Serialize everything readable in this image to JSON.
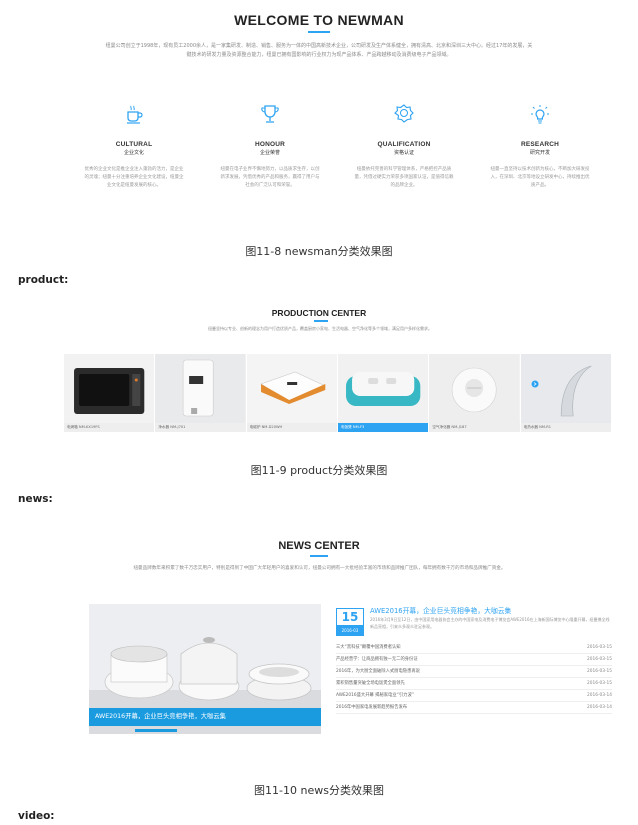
{
  "about": {
    "title": "WELCOME TO NEWMAN",
    "paragraph": "纽曼公司创立于1998年，现有员工2000余人，是一家集研发、制造、销售、服务为一体的中国高新技术企业，公司研发及生产体系健全，拥有清高、北京和深圳三大中心。经过17年的发展，关键技术的研发力量及资源整合能力，纽曼已拥有国影响的行业权力为现产品体系、产品跨越移动及消费级电子产品领域。",
    "features": [
      {
        "icon": "cup-icon",
        "title": "CULTURAL",
        "subtitle": "企业文化",
        "desc": "优秀的企业文化是推企业注入蓬勃的活力，是企业的灵魂；纽曼十分注重培养企业文化建设，纽曼企业文化是纽曼发展的核心。"
      },
      {
        "icon": "trophy-icon",
        "title": "HONOUR",
        "subtitle": "企业荣誉",
        "desc": "纽曼在电子业界不懈地努力，以品质求生存，以创新求发展，凭借优秀的产品和服务，赢得了用户与社会的广泛认可和荣誉。"
      },
      {
        "icon": "badge-icon",
        "title": "QUALIFICATION",
        "subtitle": "资格认证",
        "desc": "纽曼依托完善的科学管理体系，严格把控产品质量，凭借过硬实力荣获多项国家认证，是值得信赖的品牌企业。"
      },
      {
        "icon": "lightbulb-icon",
        "title": "RESEARCH",
        "subtitle": "研究开发",
        "desc": "纽曼一直坚持以技术创新为核心，不断加大研发投入，在深圳、北京等地设立研发中心，持续推出优质产品。"
      }
    ]
  },
  "captions": {
    "fig8": "图11-8 newsman分类效果图",
    "fig9": "图11-9 product分类效果图",
    "fig10": "图11-10 news分类效果图"
  },
  "labels": {
    "product": "product:",
    "news": "news:",
    "video": "video:"
  },
  "product": {
    "title": "PRODUCTION CENTER",
    "paragraph": "纽曼坚持以专业、创新的理念为用户打造优质产品，覆盖厨房小家电、生活电器、空气净化等多个领域，满足用户多样化需求。",
    "items": [
      {
        "name": "电烤箱 NM-KX19FS",
        "color": "#2b2b2b"
      },
      {
        "name": "净水器 NM-J701",
        "color": "#e8e8ea"
      },
      {
        "name": "电磁炉 NM-D20WH",
        "color": "#ececec"
      },
      {
        "name": "电饭煲 NM-F3",
        "color": "#37b8c4"
      },
      {
        "name": "空气净化器 NM-J187",
        "color": "#dcdcdc"
      },
      {
        "name": "电热水器 NM-R1",
        "color": "#cfd4d8"
      }
    ]
  },
  "news": {
    "title": "NEWS CENTER",
    "paragraph": "纽曼品牌数年来积累了数千万忠实用户，特别是得到了中国广大年轻用户的喜爱和认可，纽曼公司拥有一大批经验丰富的市场和品牌推广团队，每年拥有数千万的市场和品牌推广资金。",
    "banner": "AWE2016开幕，企业巨头竞相争艳，大咖云集",
    "featured": {
      "day": "15",
      "month": "2016-03",
      "headline": "AWE2016开幕，企业巨头竞相争艳，大咖云集",
      "summary": "2016年3月9日至12日，由中国家用电器协会主办的中国家电及消费电子博览会AWE2016在上海新国际博览中心隆重开幕，纽曼携全线新品亮相，引来众多观众驻足参观。"
    },
    "items": [
      {
        "title": "三大“黑科技”颠覆中国消费者认知",
        "date": "2016-03-15"
      },
      {
        "title": "产品经营学：让商品拥有独一无二的身份证",
        "date": "2016-03-15"
      },
      {
        "title": "2016年，为大厨全面破除入式厨电隐患再说",
        "date": "2016-03-15"
      },
      {
        "title": "累积销售量突破全场电饭煲全面领先",
        "date": "2016-03-15"
      },
      {
        "title": "AWE2016盛大开幕 揭秘家电业“引力波”",
        "date": "2016-03-14"
      },
      {
        "title": "2016年中国家电发展新趋势报告发布",
        "date": "2016-03-14"
      }
    ]
  },
  "colors": {
    "accent": "#2ea3f2"
  }
}
